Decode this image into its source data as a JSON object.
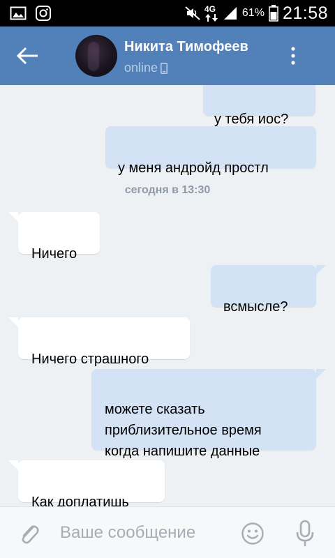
{
  "status_bar": {
    "battery_pct": "61%",
    "time": "21:58",
    "network": "4G",
    "icons": [
      "image-icon",
      "instagram-icon",
      "mute-icon",
      "signal-icon",
      "battery-icon"
    ]
  },
  "header": {
    "contact_name": "Никита Тимофеев",
    "status": "online",
    "icons": [
      "back-arrow-icon",
      "avatar",
      "mobile-phone-icon",
      "more-vertical-icon"
    ],
    "color": "#5181b8"
  },
  "messages": [
    {
      "direction": "out",
      "text": "у тебя иос?"
    },
    {
      "direction": "out",
      "text": "у меня андройд простл"
    },
    {
      "type": "date",
      "text": "сегодня в 13:30"
    },
    {
      "direction": "in",
      "text": "Ничего"
    },
    {
      "direction": "out",
      "text": "всмысле?"
    },
    {
      "direction": "in",
      "text": "Ничего страшного"
    },
    {
      "direction": "out",
      "text": "можете сказать\nприблизительное время\nкогда напишите данные"
    },
    {
      "direction": "in",
      "text": "Как доплатишь"
    }
  ],
  "composer": {
    "placeholder": "Ваше сообщение",
    "icons": [
      "paperclip-icon",
      "smiley-icon",
      "microphone-icon"
    ]
  },
  "colors": {
    "outgoing_bubble": "#d3e2f5",
    "incoming_bubble": "#ffffff",
    "background": "#eef1f4"
  }
}
